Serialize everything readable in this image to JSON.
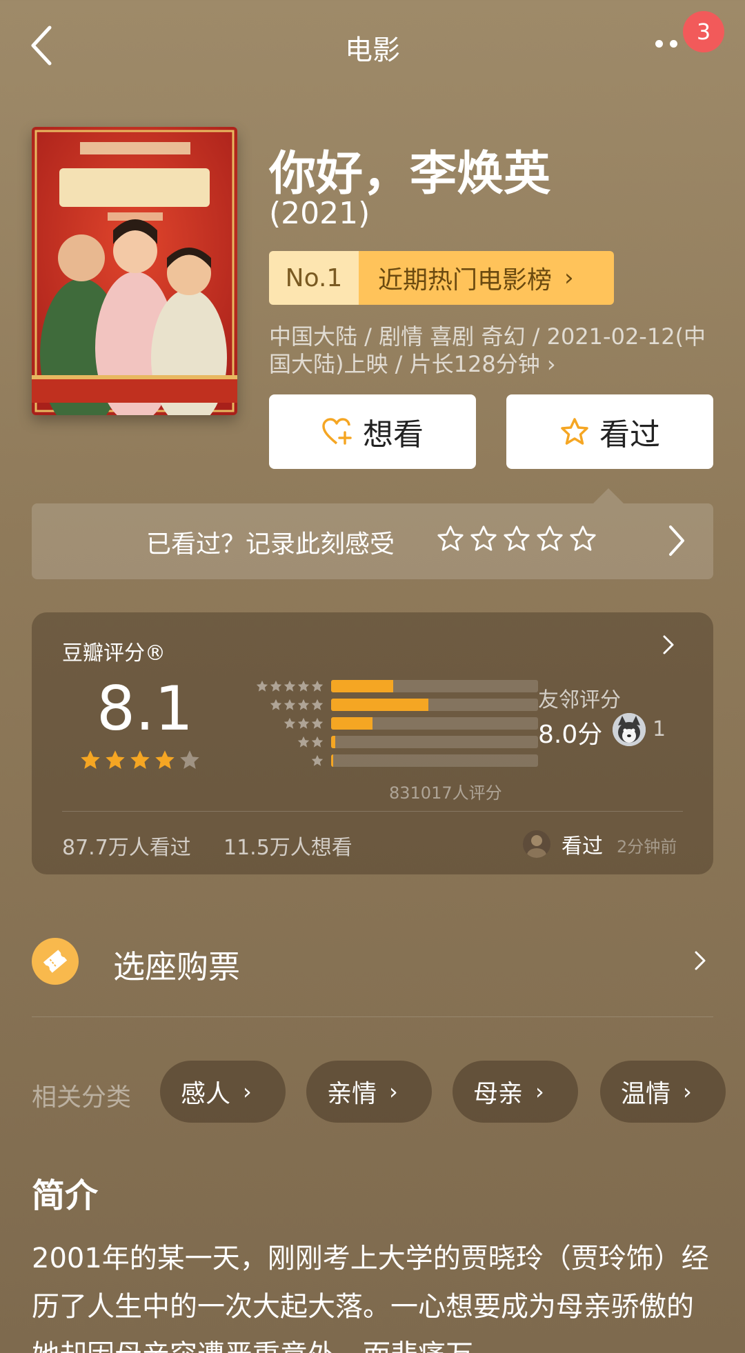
{
  "header": {
    "title": "电影",
    "notification_count": "3"
  },
  "movie": {
    "title": "你好，李焕英",
    "year": "(2021)",
    "rank_no": "No.1",
    "rank_list": "近期热门电影榜",
    "meta": "中国大陆 / 剧情 喜剧 奇幻 / 2021-02-12(中国大陆)上映 / 片长128分钟 ›",
    "poster_icon": "movie-poster"
  },
  "actions": {
    "want_label": "想看",
    "seen_label": "看过"
  },
  "record": {
    "prompt": "已看过？记录此刻感受"
  },
  "rating": {
    "label": "豆瓣评分®",
    "score": "8.1",
    "stars": 4,
    "distribution": [
      {
        "stars": 5,
        "fraction": 0.3
      },
      {
        "stars": 4,
        "fraction": 0.47
      },
      {
        "stars": 3,
        "fraction": 0.2
      },
      {
        "stars": 2,
        "fraction": 0.02
      },
      {
        "stars": 1,
        "fraction": 0.01
      }
    ],
    "count": "831017人评分",
    "friend_label": "友邻评分",
    "friend_score": "8.0分",
    "friend_count": "1",
    "seen_stat": "87.7万人看过",
    "want_stat": "11.5万人想看",
    "activity_text": "看过",
    "activity_time": "2分钟前"
  },
  "ticket": {
    "label": "选座购票"
  },
  "tags": {
    "label": "相关分类",
    "items": [
      "感人",
      "亲情",
      "母亲",
      "温情"
    ]
  },
  "synopsis": {
    "title": "简介",
    "text": "2001年的某一天，刚刚考上大学的贾晓玲（贾玲饰）经历了人生中的一次大起大落。一心想要成为母亲骄傲的她却因母亲突遭严重意外，而悲痛万"
  },
  "colors": {
    "accent": "#f5a623",
    "badge": "#f25a5a",
    "rank_bg": "#ffc35a"
  }
}
